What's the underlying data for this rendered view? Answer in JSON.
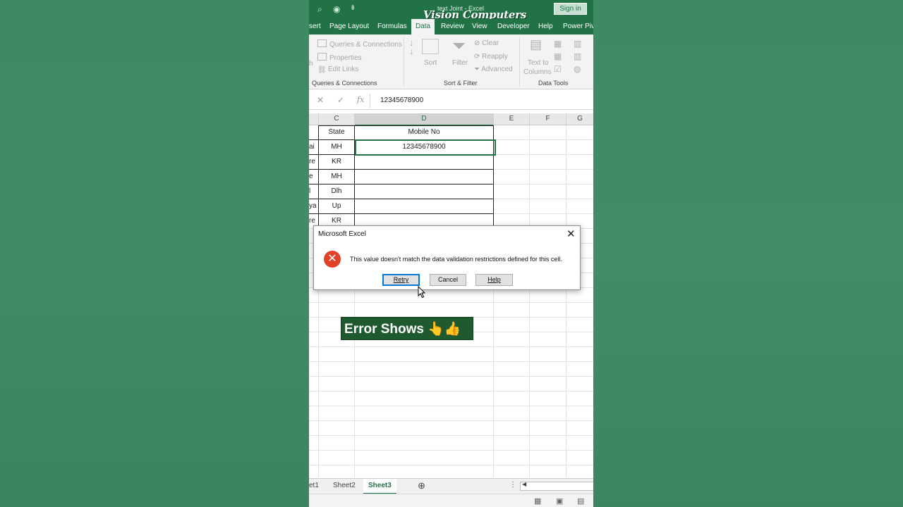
{
  "title_bar": {
    "doc_title": "text Joint  -  Excel",
    "brand_overlay": "Vision Computers",
    "sign_in": "Sign in"
  },
  "ribbon_tabs": [
    "sert",
    "Page Layout",
    "Formulas",
    "Data",
    "Review",
    "View",
    "Developer",
    "Help",
    "Power Pivo"
  ],
  "active_tab": "Data",
  "ribbon": {
    "queries_items": [
      "Queries & Connections",
      "Properties",
      "Edit Links"
    ],
    "queries_group": "Queries & Connections",
    "sort_label": "Sort",
    "filter_label": "Filter",
    "clear_label": "Clear",
    "reapply_label": "Reapply",
    "advanced_label": "Advanced",
    "sort_filter_group": "Sort & Filter",
    "text_to_columns": [
      "Text to",
      "Columns"
    ],
    "data_tools_group": "Data Tools",
    "left_fragment_1": "h"
  },
  "formula_bar": {
    "cancel_symbol": "✕",
    "enter_symbol": "✓",
    "fx_symbol": "fx",
    "value": "12345678900"
  },
  "columns": [
    "C",
    "D",
    "E",
    "F",
    "G"
  ],
  "sheet": {
    "headers": [
      "State",
      "Mobile No"
    ],
    "rows": [
      {
        "b": "ai",
        "c": "MH",
        "d": "12345678900"
      },
      {
        "b": "re",
        "c": "KR",
        "d": ""
      },
      {
        "b": "e",
        "c": "MH",
        "d": ""
      },
      {
        "b": "l",
        "c": "Dlh",
        "d": ""
      },
      {
        "b": "ya",
        "c": "Up",
        "d": ""
      },
      {
        "b": "re",
        "c": "KR",
        "d": ""
      }
    ]
  },
  "dialog": {
    "title": "Microsoft Excel",
    "message": "This value doesn't match the data validation restrictions defined for this cell.",
    "retry": "Retry",
    "cancel": "Cancel",
    "help": "Help"
  },
  "overlay_caption": "Error Shows 👆👍",
  "sheet_tabs": [
    "et1",
    "Sheet2",
    "Sheet3"
  ],
  "active_sheet": "Sheet3",
  "colors": {
    "excel_green": "#217346",
    "background_green": "#3f8a63",
    "error_red": "#e2412a",
    "caption_bg": "#1e5a2e"
  }
}
